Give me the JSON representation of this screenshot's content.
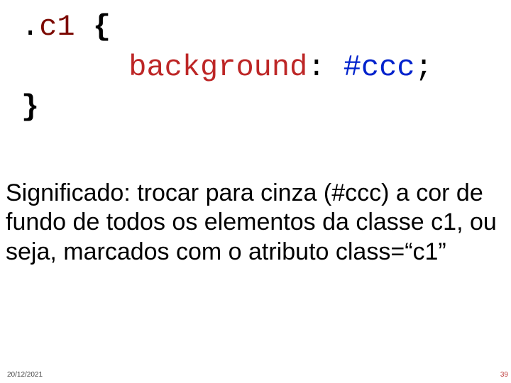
{
  "code": {
    "dot": ".",
    "selector": "c1",
    "brace_open": "{",
    "indent": "      ",
    "property": "background",
    "colon": ":",
    "value": "#ccc",
    "semicolon": ";",
    "brace_close": "}"
  },
  "explanation": "Significado: trocar para cinza (#ccc) a cor de fundo de todos os elementos da classe c1, ou seja, marcados com o atributo class=“c1”",
  "footer": {
    "date": "20/12/2021",
    "page": "39"
  }
}
